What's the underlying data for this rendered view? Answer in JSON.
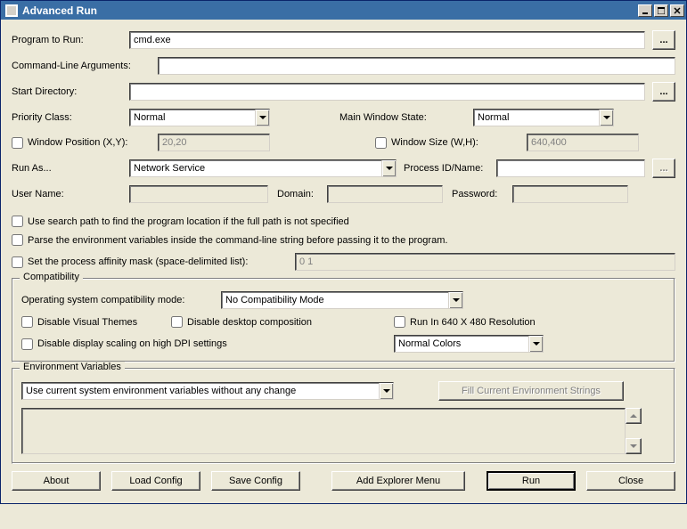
{
  "window": {
    "title": "Advanced Run"
  },
  "labels": {
    "program": "Program to Run:",
    "args": "Command-Line Arguments:",
    "startdir": "Start Directory:",
    "priority": "Priority Class:",
    "windowstate": "Main Window State:",
    "windowpos": "Window Position (X,Y):",
    "windowsize": "Window Size (W,H):",
    "runas": "Run As...",
    "procid": "Process ID/Name:",
    "username": "User Name:",
    "domain": "Domain:",
    "password": "Password:",
    "searchpath": "Use search path to find the program location if the full path is not specified",
    "parseenv": "Parse the environment variables inside the command-line string before passing it to the program.",
    "affinity": "Set the process affinity mask (space-delimited list):",
    "compat_title": "Compatibility",
    "compat_mode": "Operating system compatibility mode:",
    "compat_disable_themes": "Disable Visual Themes",
    "compat_disable_comp": "Disable desktop composition",
    "compat_640": "Run In 640 X 480 Resolution",
    "compat_dpi": "Disable display scaling on high DPI settings",
    "env_title": "Environment Variables",
    "env_fill": "Fill Current Environment Strings"
  },
  "values": {
    "program": "cmd.exe",
    "args": "",
    "startdir": "",
    "priority": "Normal",
    "windowstate": "Normal",
    "windowpos": "20,20",
    "windowsize": "640,400",
    "runas": "Network Service",
    "procid": "",
    "username": "",
    "domain": "",
    "password": "",
    "affinity": "0 1",
    "compat_mode": "No Compatibility Mode",
    "colors": "Normal Colors",
    "env_mode": "Use current system environment variables without any change",
    "env_text": ""
  },
  "buttons": {
    "browse": "...",
    "about": "About",
    "load": "Load Config",
    "save": "Save Config",
    "explorer": "Add Explorer Menu",
    "run": "Run",
    "close": "Close"
  }
}
